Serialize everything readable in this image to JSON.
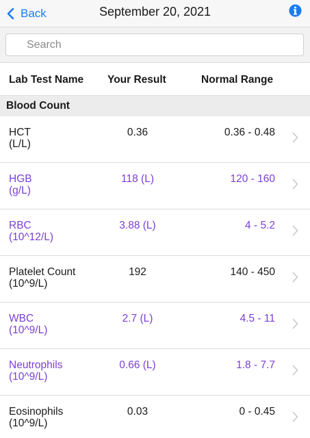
{
  "nav": {
    "back_label": "Back",
    "title": "September 20, 2021"
  },
  "search": {
    "placeholder": "Search"
  },
  "columns": {
    "name": "Lab Test Name",
    "result": "Your Result",
    "range": "Normal Range"
  },
  "section": {
    "title": "Blood Count"
  },
  "colors": {
    "accent": "#1a7cf5",
    "abnormal": "#7b3fd4"
  },
  "rows": [
    {
      "name": "HCT",
      "unit": "(L/L)",
      "result": "0.36",
      "range": "0.36 - 0.48",
      "abnormal": false
    },
    {
      "name": "HGB",
      "unit": "(g/L)",
      "result": "118 (L)",
      "range": "120 - 160",
      "abnormal": true
    },
    {
      "name": "RBC",
      "unit": "(10^12/L)",
      "result": "3.88 (L)",
      "range": "4 - 5.2",
      "abnormal": true
    },
    {
      "name": "Platelet Count",
      "unit": "(10^9/L)",
      "result": "192",
      "range": "140 - 450",
      "abnormal": false
    },
    {
      "name": "WBC",
      "unit": "(10^9/L)",
      "result": "2.7 (L)",
      "range": "4.5 - 11",
      "abnormal": true
    },
    {
      "name": "Neutrophils",
      "unit": "(10^9/L)",
      "result": "0.66 (L)",
      "range": "1.8 - 7.7",
      "abnormal": true
    },
    {
      "name": "Eosinophils",
      "unit": "(10^9/L)",
      "result": "0.03",
      "range": "0 - 0.45",
      "abnormal": false
    }
  ]
}
